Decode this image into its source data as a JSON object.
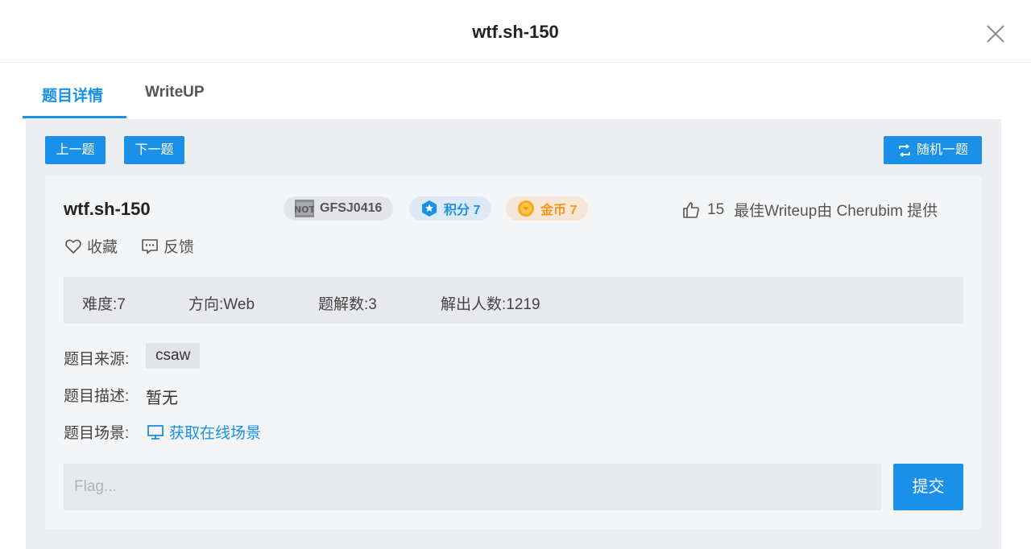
{
  "modal": {
    "title": "wtf.sh-150"
  },
  "tabs": [
    {
      "label": "题目详情",
      "active": true
    },
    {
      "label": "WriteUP",
      "active": false
    }
  ],
  "nav": {
    "prev_label": "上一题",
    "next_label": "下一题",
    "random_label": "随机一题"
  },
  "challenge": {
    "name": "wtf.sh-150",
    "id": "GFSJ0416",
    "score_label": "积分 7",
    "coin_label": "金币 7",
    "likes": "15",
    "best_writeup": "最佳Writeup由 Cherubim 提供",
    "favorite_label": "收藏",
    "feedback_label": "反馈"
  },
  "stats": [
    {
      "label": "难度:",
      "value": "7"
    },
    {
      "label": "方向:",
      "value": "Web"
    },
    {
      "label": "题解数:",
      "value": "3"
    },
    {
      "label": "解出人数:",
      "value": "1219"
    }
  ],
  "details": {
    "source_label": "题目来源:",
    "source_value": "csaw",
    "desc_label": "题目描述:",
    "desc_value": "暂无",
    "scene_label": "题目场景:",
    "scene_link": "获取在线场景"
  },
  "flag": {
    "placeholder": "Flag...",
    "submit_label": "提交"
  },
  "colors": {
    "accent": "#1a90e8",
    "coin": "#f29718",
    "panel": "#eceef2"
  }
}
